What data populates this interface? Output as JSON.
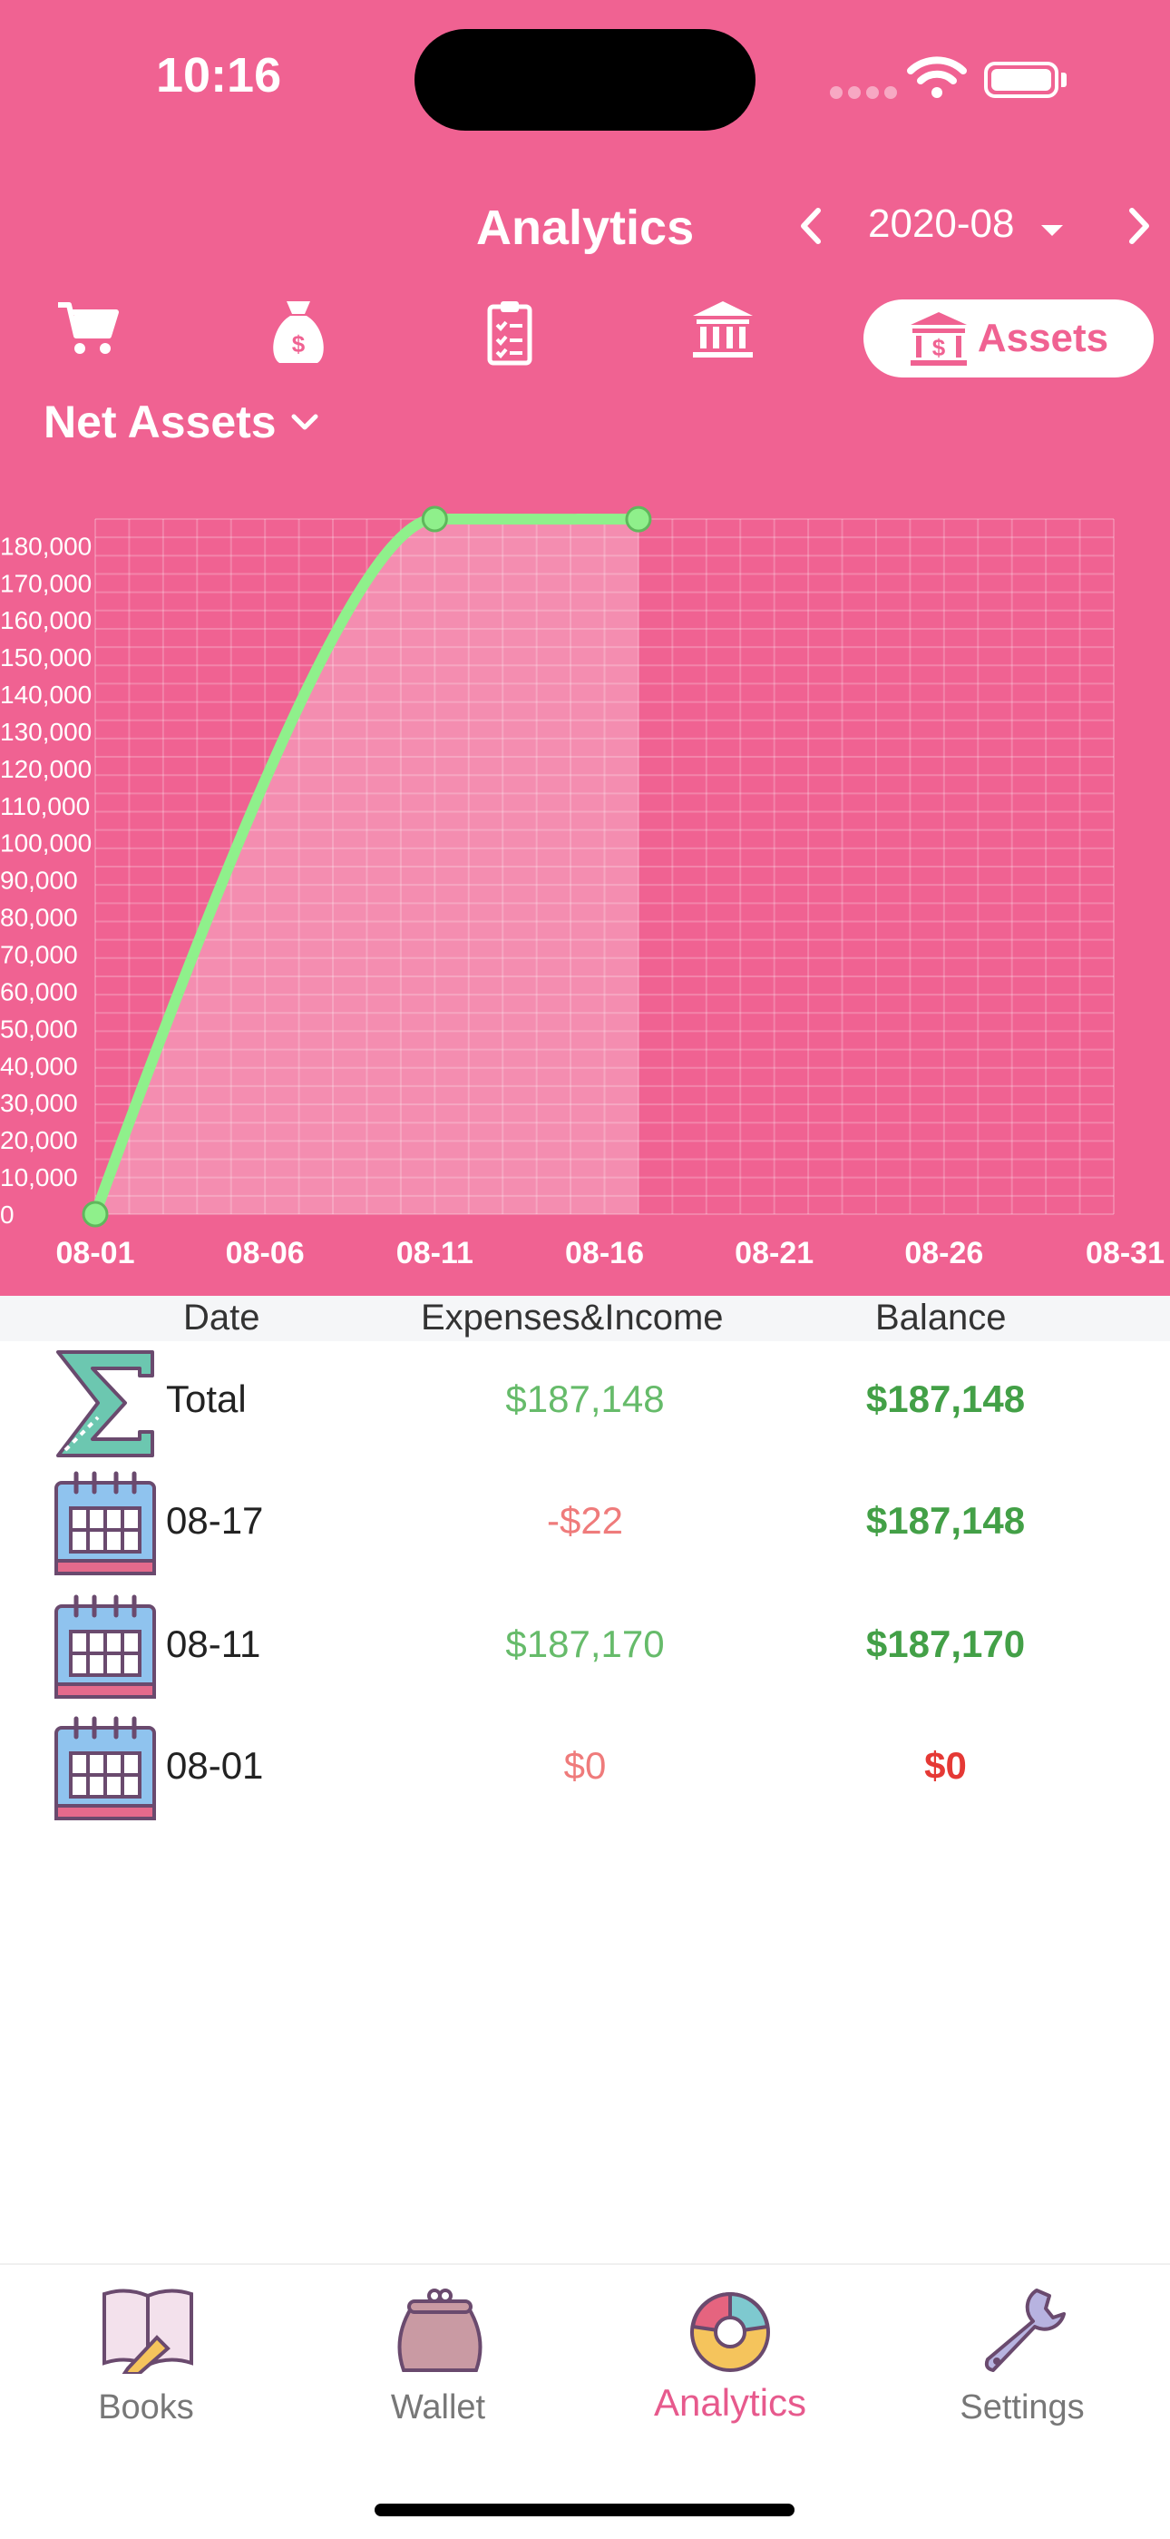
{
  "status_bar": {
    "time": "10:16"
  },
  "header": {
    "title": "Analytics",
    "month": "2020-08",
    "assets_tab_label": "Assets",
    "net_assets_label": "Net Assets"
  },
  "category_tabs": [
    {
      "icon": "cart-icon",
      "active": false
    },
    {
      "icon": "money-bag-icon",
      "active": false
    },
    {
      "icon": "clipboard-icon",
      "active": false
    },
    {
      "icon": "bank-icon",
      "active": false
    },
    {
      "icon": "bank-dollar-icon",
      "active": true,
      "label": "Assets"
    }
  ],
  "table": {
    "headers": [
      "Date",
      "Expenses&Income",
      "Balance"
    ],
    "rows": [
      {
        "icon": "sigma-icon",
        "label": "Total",
        "amount": "$187,148",
        "balance": "$187,148",
        "amount_color": "#66bb6a",
        "balance_color": "#43a047"
      },
      {
        "icon": "calendar-icon",
        "label": "08-17",
        "amount": "-$22",
        "balance": "$187,148",
        "amount_color": "#ef7b7b",
        "balance_color": "#43a047"
      },
      {
        "icon": "calendar-icon",
        "label": "08-11",
        "amount": "$187,170",
        "balance": "$187,170",
        "amount_color": "#66bb6a",
        "balance_color": "#43a047"
      },
      {
        "icon": "calendar-icon",
        "label": "08-01",
        "amount": "$0",
        "balance": "$0",
        "amount_color": "#ef7b7b",
        "balance_color": "#e53935"
      }
    ]
  },
  "bottom_tabs": [
    {
      "label": "Books",
      "icon": "book-pencil-icon",
      "active": false
    },
    {
      "label": "Wallet",
      "icon": "purse-icon",
      "active": false
    },
    {
      "label": "Analytics",
      "icon": "pie-chart-icon",
      "active": true
    },
    {
      "label": "Settings",
      "icon": "wrench-icon",
      "active": false
    }
  ],
  "colors": {
    "header_bg": "#f06292",
    "line": "#8ff08b",
    "positive": "#43a047",
    "negative": "#e53935",
    "active_tab": "#e75a8d"
  },
  "chart_data": {
    "type": "area",
    "x": [
      "08-01",
      "08-11",
      "08-17"
    ],
    "values": [
      0,
      187170,
      187148
    ],
    "x_ticks": [
      "08-01",
      "08-06",
      "08-11",
      "08-16",
      "08-21",
      "08-26",
      "08-31"
    ],
    "x_range_days": [
      1,
      31
    ],
    "y_ticks": [
      "0",
      "10,000",
      "20,000",
      "30,000",
      "40,000",
      "50,000",
      "60,000",
      "70,000",
      "80,000",
      "90,000",
      "100,000",
      "110,000",
      "120,000",
      "130,000",
      "140,000",
      "150,000",
      "160,000",
      "170,000",
      "180,000"
    ],
    "ylim": [
      0,
      187170
    ],
    "grid": true,
    "legend": "none"
  }
}
